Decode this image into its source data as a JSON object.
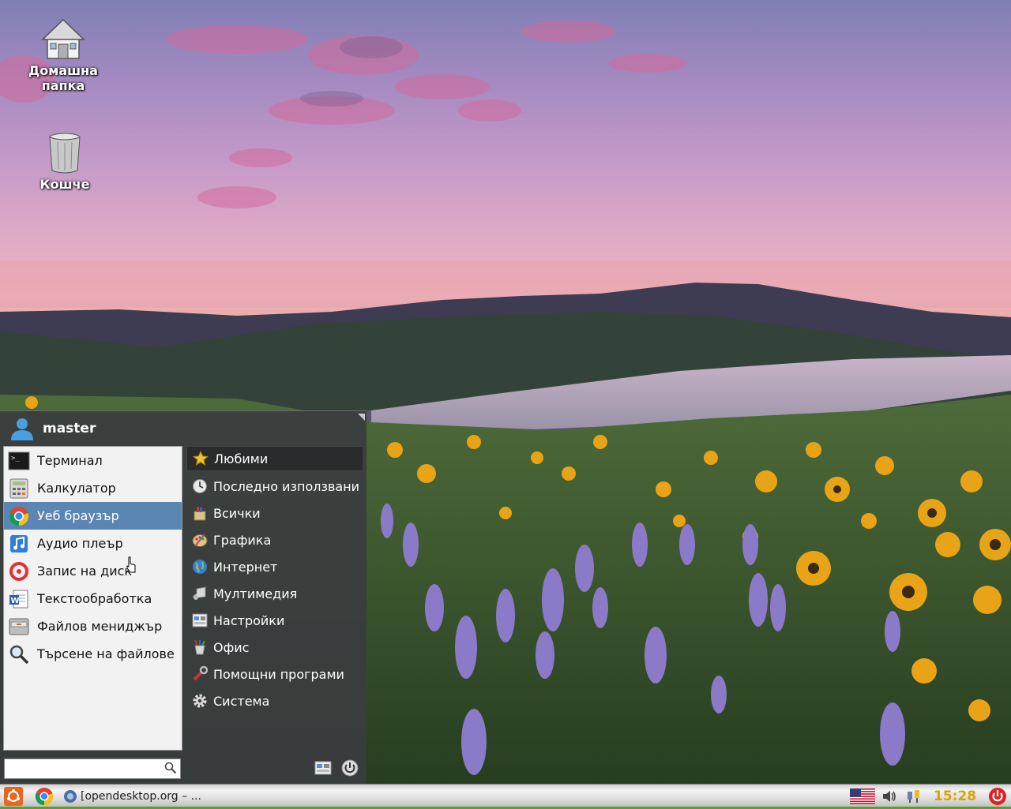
{
  "desktop": {
    "icons": [
      {
        "label_line1": "Домашна",
        "label_line2": "папка",
        "icon": "home-folder-icon"
      },
      {
        "label_line1": "Кошче",
        "label_line2": "",
        "icon": "trash-icon"
      }
    ]
  },
  "menu": {
    "user": {
      "name": "master",
      "icon": "user-icon"
    },
    "favorites": [
      {
        "label": "Терминал",
        "icon": "terminal-icon"
      },
      {
        "label": "Калкулатор",
        "icon": "calculator-icon"
      },
      {
        "label": "Уеб браузър",
        "icon": "browser-icon",
        "highlighted": true
      },
      {
        "label": "Аудио плеър",
        "icon": "music-icon"
      },
      {
        "label": "Запис на диск",
        "icon": "disc-burner-icon"
      },
      {
        "label": "Текстообработка",
        "icon": "word-processor-icon"
      },
      {
        "label": "Файлов мениджър",
        "icon": "file-manager-icon"
      },
      {
        "label": "Търсене на файлове",
        "icon": "search-files-icon"
      }
    ],
    "categories": [
      {
        "label": "Любими",
        "icon": "star-icon",
        "active": true
      },
      {
        "label": "Последно използвани",
        "icon": "clock-icon"
      },
      {
        "label": "Всички",
        "icon": "all-apps-icon"
      },
      {
        "label": "Графика",
        "icon": "graphics-icon"
      },
      {
        "label": "Интернет",
        "icon": "globe-icon"
      },
      {
        "label": "Мултимедия",
        "icon": "multimedia-icon"
      },
      {
        "label": "Настройки",
        "icon": "settings-icon"
      },
      {
        "label": "Офис",
        "icon": "office-icon"
      },
      {
        "label": "Помощни програми",
        "icon": "utilities-icon"
      },
      {
        "label": "Система",
        "icon": "gear-icon"
      }
    ],
    "search": {
      "value": "",
      "placeholder": ""
    }
  },
  "taskbar": {
    "task_label": "[opendesktop.org – ...",
    "clock": "15:28",
    "colors": {
      "accent_green": "#5b9e2b",
      "clock": "#d8a400",
      "menu_button": "#e8661e"
    }
  }
}
